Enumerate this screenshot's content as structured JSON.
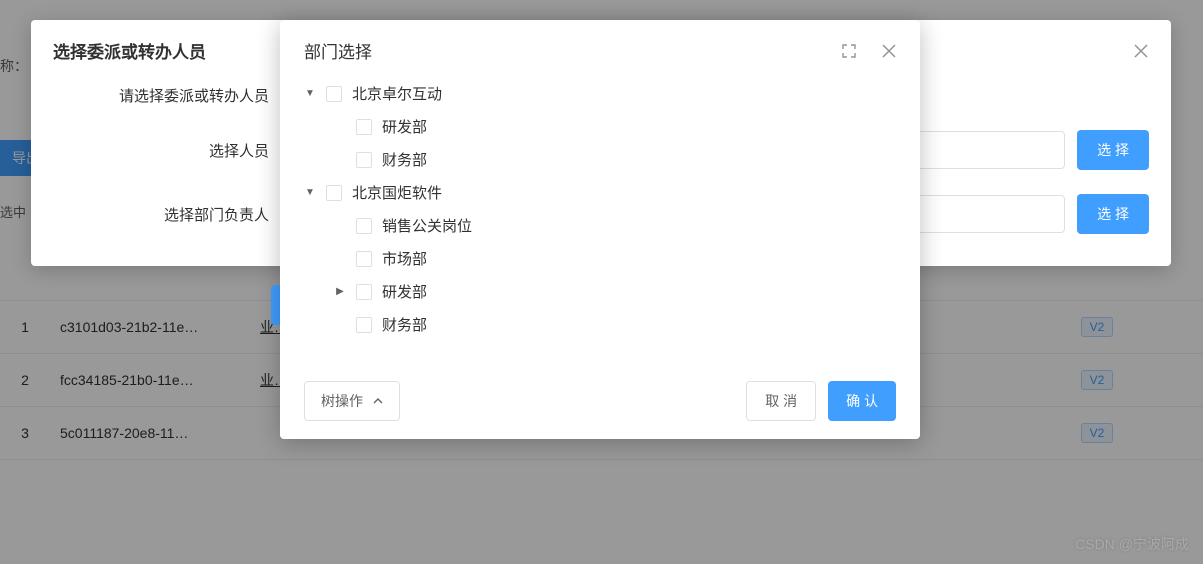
{
  "background": {
    "label_suffix": "称：",
    "export_label": "导出",
    "selected_label": "选中",
    "rows": [
      {
        "idx": "1",
        "uuid": "c3101d03-21b2-11e…",
        "biz": "业…",
        "tag": "V2"
      },
      {
        "idx": "2",
        "uuid": "fcc34185-21b0-11e…",
        "biz": "业…",
        "tag": "V2"
      },
      {
        "idx": "3",
        "uuid": "5c011187-20e8-11…",
        "biz": "",
        "tag": "V2"
      }
    ]
  },
  "outer_modal": {
    "title": "选择委派或转办人员",
    "row1_label": "请选择委派或转办人员",
    "row2_label": "选择人员",
    "row3_label": "选择部门负责人",
    "select_button": "选 择"
  },
  "inner_modal": {
    "title": "部门选择",
    "tree": [
      {
        "level": 1,
        "label": "北京卓尔互动",
        "caret": "down"
      },
      {
        "level": 2,
        "label": "研发部",
        "caret": ""
      },
      {
        "level": 2,
        "label": "财务部",
        "caret": ""
      },
      {
        "level": 1,
        "label": "北京国炬软件",
        "caret": "down"
      },
      {
        "level": 2,
        "label": "销售公关岗位",
        "caret": ""
      },
      {
        "level": 2,
        "label": "市场部",
        "caret": ""
      },
      {
        "level": 2,
        "label": "研发部",
        "caret": "right"
      },
      {
        "level": 2,
        "label": "财务部",
        "caret": ""
      }
    ],
    "tree_ops": "树操作",
    "cancel": "取 消",
    "confirm": "确 认"
  },
  "watermark": "CSDN @宁波阿成"
}
